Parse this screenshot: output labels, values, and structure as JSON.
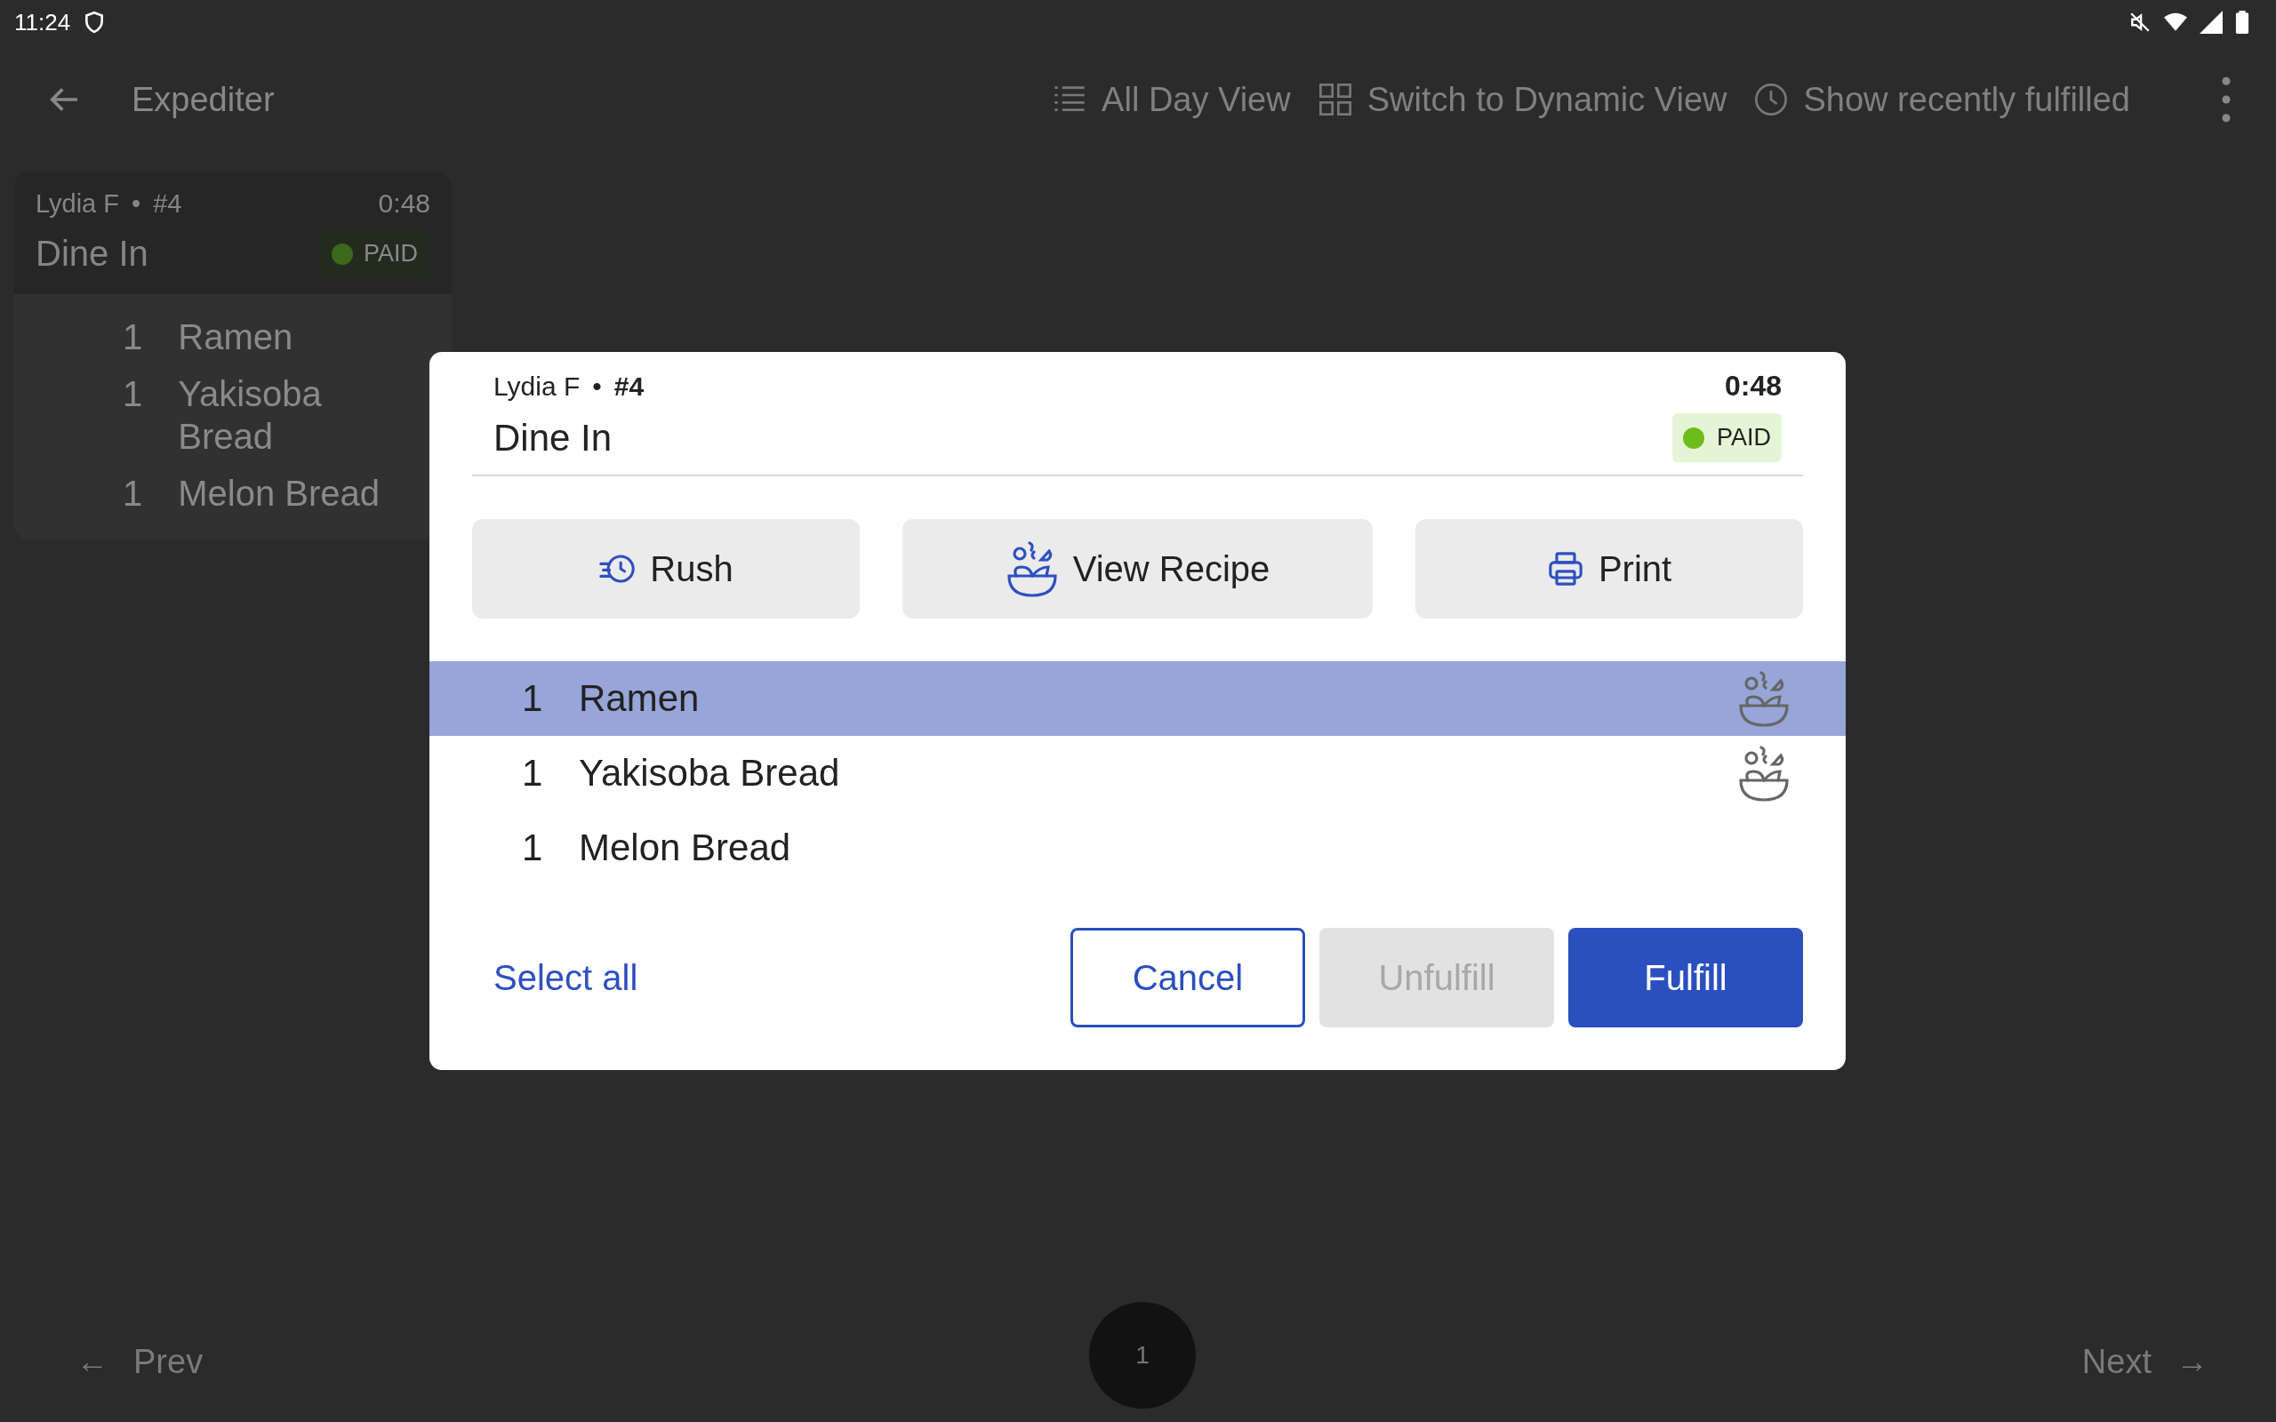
{
  "status_bar": {
    "time": "11:24"
  },
  "app_bar": {
    "title": "Expediter",
    "actions": [
      {
        "kind": "list",
        "label": "All Day View"
      },
      {
        "kind": "grid",
        "label": "Switch to Dynamic View"
      },
      {
        "kind": "clock",
        "label": "Show recently fulfilled"
      }
    ]
  },
  "order_card": {
    "customer": "Lydia F",
    "separator": "•",
    "number": "#4",
    "time": "0:48",
    "type": "Dine In",
    "badge": "PAID"
  },
  "background_items": [
    {
      "qty": "1",
      "name": "Ramen"
    },
    {
      "qty": "1",
      "name": "Yakisoba Bread"
    },
    {
      "qty": "1",
      "name": "Melon Bread"
    }
  ],
  "dialog": {
    "customer": "Lydia F",
    "separator": "•",
    "number": "#4",
    "time": "0:48",
    "type": "Dine In",
    "badge": "PAID",
    "actions": [
      {
        "kind": "rush",
        "label": "Rush"
      },
      {
        "kind": "recipe",
        "label": "View Recipe"
      },
      {
        "kind": "print",
        "label": "Print"
      }
    ],
    "items": [
      {
        "qty": "1",
        "name": "Ramen",
        "selected": true,
        "has_recipe": true
      },
      {
        "qty": "1",
        "name": "Yakisoba Bread",
        "selected": false,
        "has_recipe": true
      },
      {
        "qty": "1",
        "name": "Melon Bread",
        "selected": false,
        "has_recipe": false
      }
    ],
    "buttons": [
      {
        "kind": "text",
        "label": "Select all"
      },
      {
        "kind": "outlined",
        "label": "Cancel"
      },
      {
        "kind": "disabled",
        "label": "Unfulfill"
      },
      {
        "kind": "filled",
        "label": "Fulfill"
      }
    ]
  },
  "pager": {
    "prev_arrow": "←",
    "prev": "Prev",
    "page": "1",
    "next": "Next",
    "next_arrow": "→"
  }
}
